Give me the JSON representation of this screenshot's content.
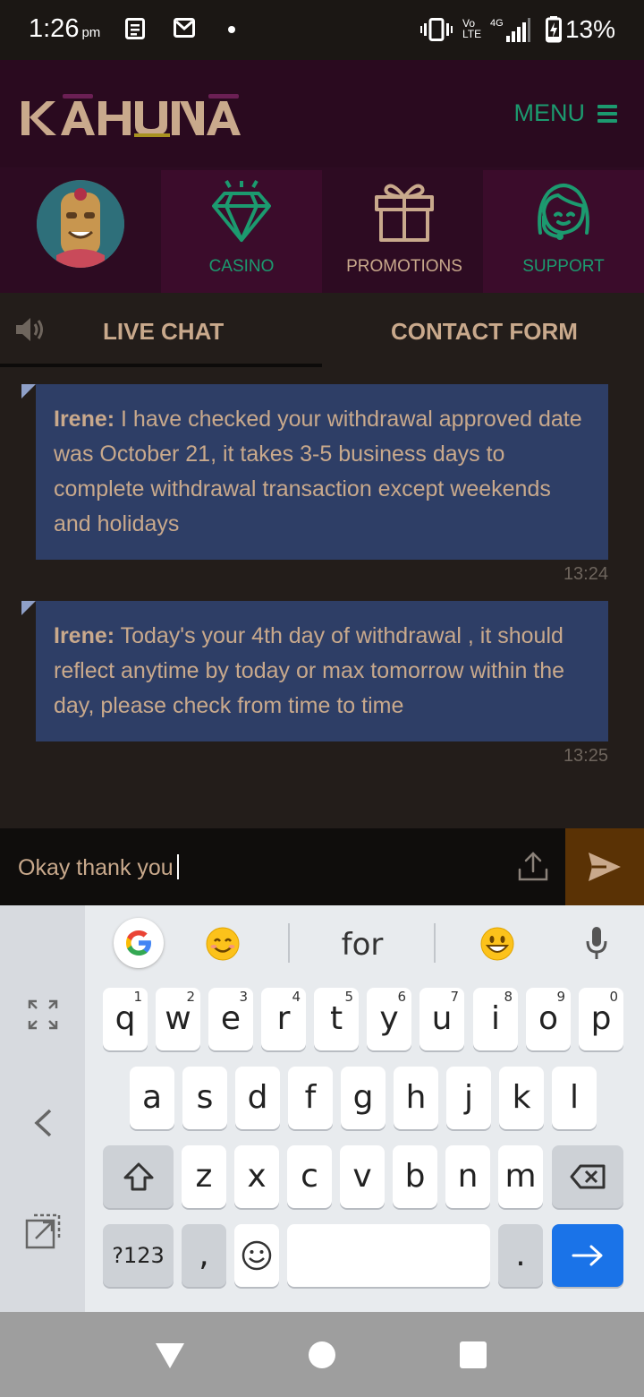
{
  "status_bar": {
    "time": "1:26",
    "ampm": "pm",
    "battery": "13%",
    "network": "4G",
    "volte_top": "Vo",
    "volte_bottom": "LTE"
  },
  "header": {
    "logo_text": "KAHUNA",
    "menu_label": "MENU",
    "brand_colors": {
      "header_bg": "#2a0a1f",
      "accent_green": "#1c9a6f",
      "gold": "#c9a98c"
    }
  },
  "nav": {
    "casino": "CASINO",
    "promotions": "PROMOTIONS",
    "support": "SUPPORT"
  },
  "tabs": {
    "live_chat": "LIVE CHAT",
    "contact_form": "CONTACT FORM"
  },
  "messages": [
    {
      "sender": "Irene:",
      "text": " I have checked your withdrawal approved date was October 21, it takes 3-5 business days to complete withdrawal transaction except weekends and holidays",
      "time": "13:24"
    },
    {
      "sender": "Irene:",
      "text": " Today's your 4th day of withdrawal , it should reflect anytime by today or max tomorrow within the day, please check from time to time",
      "time": "13:25"
    }
  ],
  "composer": {
    "value": "Okay thank you"
  },
  "keyboard": {
    "suggestion": "for",
    "row1": [
      {
        "k": "q",
        "n": "1"
      },
      {
        "k": "w",
        "n": "2"
      },
      {
        "k": "e",
        "n": "3"
      },
      {
        "k": "r",
        "n": "4"
      },
      {
        "k": "t",
        "n": "5"
      },
      {
        "k": "y",
        "n": "6"
      },
      {
        "k": "u",
        "n": "7"
      },
      {
        "k": "i",
        "n": "8"
      },
      {
        "k": "o",
        "n": "9"
      },
      {
        "k": "p",
        "n": "0"
      }
    ],
    "row2": [
      "a",
      "s",
      "d",
      "f",
      "g",
      "h",
      "j",
      "k",
      "l"
    ],
    "row3": [
      "z",
      "x",
      "c",
      "v",
      "b",
      "n",
      "m"
    ],
    "symbols_label": "?123",
    "comma": ",",
    "period": "."
  }
}
